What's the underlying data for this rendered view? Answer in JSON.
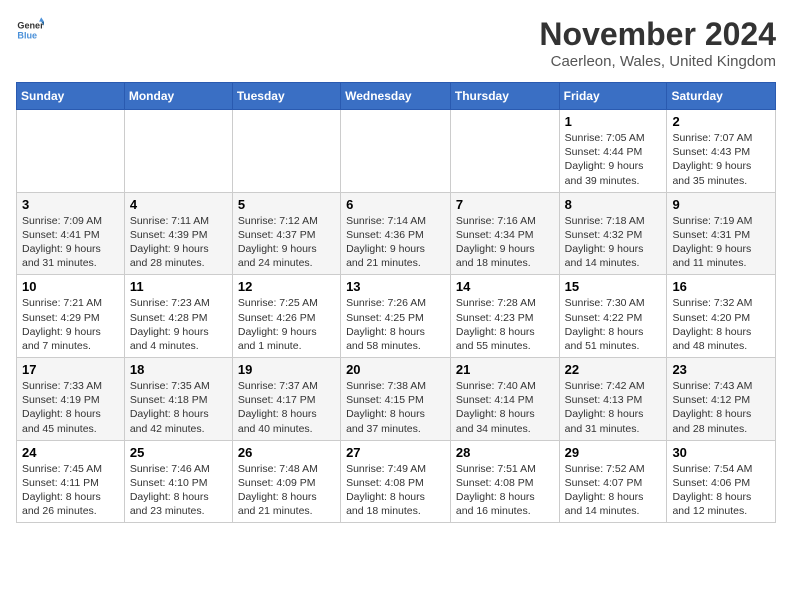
{
  "header": {
    "logo_line1": "General",
    "logo_line2": "Blue",
    "month_title": "November 2024",
    "location": "Caerleon, Wales, United Kingdom"
  },
  "days_of_week": [
    "Sunday",
    "Monday",
    "Tuesday",
    "Wednesday",
    "Thursday",
    "Friday",
    "Saturday"
  ],
  "weeks": [
    [
      {
        "day": "",
        "info": ""
      },
      {
        "day": "",
        "info": ""
      },
      {
        "day": "",
        "info": ""
      },
      {
        "day": "",
        "info": ""
      },
      {
        "day": "",
        "info": ""
      },
      {
        "day": "1",
        "info": "Sunrise: 7:05 AM\nSunset: 4:44 PM\nDaylight: 9 hours and 39 minutes."
      },
      {
        "day": "2",
        "info": "Sunrise: 7:07 AM\nSunset: 4:43 PM\nDaylight: 9 hours and 35 minutes."
      }
    ],
    [
      {
        "day": "3",
        "info": "Sunrise: 7:09 AM\nSunset: 4:41 PM\nDaylight: 9 hours and 31 minutes."
      },
      {
        "day": "4",
        "info": "Sunrise: 7:11 AM\nSunset: 4:39 PM\nDaylight: 9 hours and 28 minutes."
      },
      {
        "day": "5",
        "info": "Sunrise: 7:12 AM\nSunset: 4:37 PM\nDaylight: 9 hours and 24 minutes."
      },
      {
        "day": "6",
        "info": "Sunrise: 7:14 AM\nSunset: 4:36 PM\nDaylight: 9 hours and 21 minutes."
      },
      {
        "day": "7",
        "info": "Sunrise: 7:16 AM\nSunset: 4:34 PM\nDaylight: 9 hours and 18 minutes."
      },
      {
        "day": "8",
        "info": "Sunrise: 7:18 AM\nSunset: 4:32 PM\nDaylight: 9 hours and 14 minutes."
      },
      {
        "day": "9",
        "info": "Sunrise: 7:19 AM\nSunset: 4:31 PM\nDaylight: 9 hours and 11 minutes."
      }
    ],
    [
      {
        "day": "10",
        "info": "Sunrise: 7:21 AM\nSunset: 4:29 PM\nDaylight: 9 hours and 7 minutes."
      },
      {
        "day": "11",
        "info": "Sunrise: 7:23 AM\nSunset: 4:28 PM\nDaylight: 9 hours and 4 minutes."
      },
      {
        "day": "12",
        "info": "Sunrise: 7:25 AM\nSunset: 4:26 PM\nDaylight: 9 hours and 1 minute."
      },
      {
        "day": "13",
        "info": "Sunrise: 7:26 AM\nSunset: 4:25 PM\nDaylight: 8 hours and 58 minutes."
      },
      {
        "day": "14",
        "info": "Sunrise: 7:28 AM\nSunset: 4:23 PM\nDaylight: 8 hours and 55 minutes."
      },
      {
        "day": "15",
        "info": "Sunrise: 7:30 AM\nSunset: 4:22 PM\nDaylight: 8 hours and 51 minutes."
      },
      {
        "day": "16",
        "info": "Sunrise: 7:32 AM\nSunset: 4:20 PM\nDaylight: 8 hours and 48 minutes."
      }
    ],
    [
      {
        "day": "17",
        "info": "Sunrise: 7:33 AM\nSunset: 4:19 PM\nDaylight: 8 hours and 45 minutes."
      },
      {
        "day": "18",
        "info": "Sunrise: 7:35 AM\nSunset: 4:18 PM\nDaylight: 8 hours and 42 minutes."
      },
      {
        "day": "19",
        "info": "Sunrise: 7:37 AM\nSunset: 4:17 PM\nDaylight: 8 hours and 40 minutes."
      },
      {
        "day": "20",
        "info": "Sunrise: 7:38 AM\nSunset: 4:15 PM\nDaylight: 8 hours and 37 minutes."
      },
      {
        "day": "21",
        "info": "Sunrise: 7:40 AM\nSunset: 4:14 PM\nDaylight: 8 hours and 34 minutes."
      },
      {
        "day": "22",
        "info": "Sunrise: 7:42 AM\nSunset: 4:13 PM\nDaylight: 8 hours and 31 minutes."
      },
      {
        "day": "23",
        "info": "Sunrise: 7:43 AM\nSunset: 4:12 PM\nDaylight: 8 hours and 28 minutes."
      }
    ],
    [
      {
        "day": "24",
        "info": "Sunrise: 7:45 AM\nSunset: 4:11 PM\nDaylight: 8 hours and 26 minutes."
      },
      {
        "day": "25",
        "info": "Sunrise: 7:46 AM\nSunset: 4:10 PM\nDaylight: 8 hours and 23 minutes."
      },
      {
        "day": "26",
        "info": "Sunrise: 7:48 AM\nSunset: 4:09 PM\nDaylight: 8 hours and 21 minutes."
      },
      {
        "day": "27",
        "info": "Sunrise: 7:49 AM\nSunset: 4:08 PM\nDaylight: 8 hours and 18 minutes."
      },
      {
        "day": "28",
        "info": "Sunrise: 7:51 AM\nSunset: 4:08 PM\nDaylight: 8 hours and 16 minutes."
      },
      {
        "day": "29",
        "info": "Sunrise: 7:52 AM\nSunset: 4:07 PM\nDaylight: 8 hours and 14 minutes."
      },
      {
        "day": "30",
        "info": "Sunrise: 7:54 AM\nSunset: 4:06 PM\nDaylight: 8 hours and 12 minutes."
      }
    ]
  ]
}
